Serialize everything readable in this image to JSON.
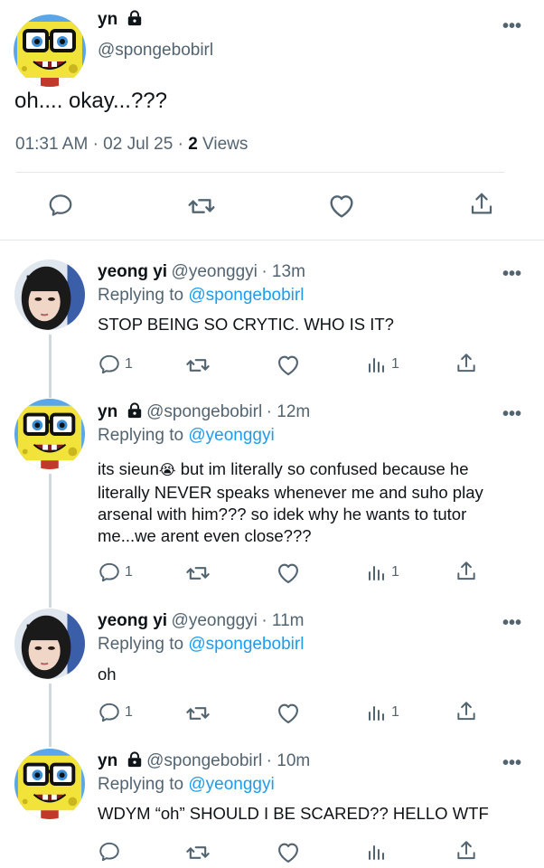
{
  "main_tweet": {
    "name": "yn",
    "handle": "@spongebobirl",
    "text": "oh.... okay...???",
    "time": "01:31 AM",
    "date": "02 Jul 25",
    "views_count": "2",
    "views_label": "Views"
  },
  "replies": [
    {
      "name": "yeong yi",
      "handle": "@yeonggyi",
      "time": "· 13m",
      "replying_label": "Replying to",
      "replying_to": "@spongebobirl",
      "text": "STOP BEING SO CRYTIC. WHO IS IT?",
      "reply_count": "1",
      "view_count": "1"
    },
    {
      "name": "yn",
      "handle": "@spongebobirl",
      "time": "· 12m",
      "replying_label": "Replying to",
      "replying_to": "@yeonggyi",
      "text_line1_a": "its sieun",
      "text_emoji": "😭",
      "text_line1_b": " but im literally so confused because he",
      "text_line2": "literally NEVER speaks whenever me and suho play",
      "text_line3": "arsenal with him??? so idek why he wants to tutor",
      "text_line4": "me...we arent even close???",
      "reply_count": "1",
      "view_count": "1"
    },
    {
      "name": "yeong yi",
      "handle": "@yeonggyi",
      "time": "· 11m",
      "replying_label": "Replying to",
      "replying_to": "@spongebobirl",
      "text": "oh",
      "reply_count": "1",
      "view_count": "1"
    },
    {
      "name": "yn",
      "handle": "@spongebobirl",
      "time": "· 10m",
      "replying_label": "Replying to",
      "replying_to": "@yeonggyi",
      "text": "WDYM “oh” SHOULD I BE SCARED?? HELLO WTF"
    }
  ],
  "icons": {
    "more": "more-icon",
    "lock": "lock-icon",
    "reply": "reply-icon",
    "retweet": "retweet-icon",
    "like": "heart-icon",
    "views": "views-icon",
    "share": "share-icon"
  },
  "colors": {
    "link": "#1d9bf0",
    "secondary": "#536471",
    "divider": "#e1e6ea"
  }
}
